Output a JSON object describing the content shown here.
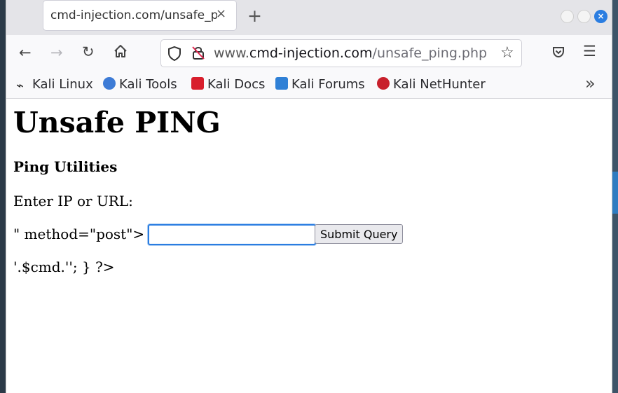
{
  "browser": {
    "tab_title": "cmd-injection.com/unsafe_ping.php",
    "tab_close": "×",
    "new_tab": "+",
    "url_host": "www.",
    "url_domain": "cmd-injection.com",
    "url_path": "/unsafe_ping.php",
    "bookmarks": [
      "Kali Linux",
      "Kali Tools",
      "Kali Docs",
      "Kali Forums",
      "Kali NetHunter"
    ],
    "bookmarks_overflow": "»"
  },
  "page": {
    "title": "Unsafe PING",
    "subtitle": "Ping Utilities",
    "prompt": "Enter IP or URL:",
    "leaked_form_text": "\" method=\"post\">",
    "input_value": "",
    "submit_label": "Submit Query",
    "leaked_php": "'.$cmd.''; } ?>"
  },
  "colors": {
    "accent": "#2a7de1"
  }
}
